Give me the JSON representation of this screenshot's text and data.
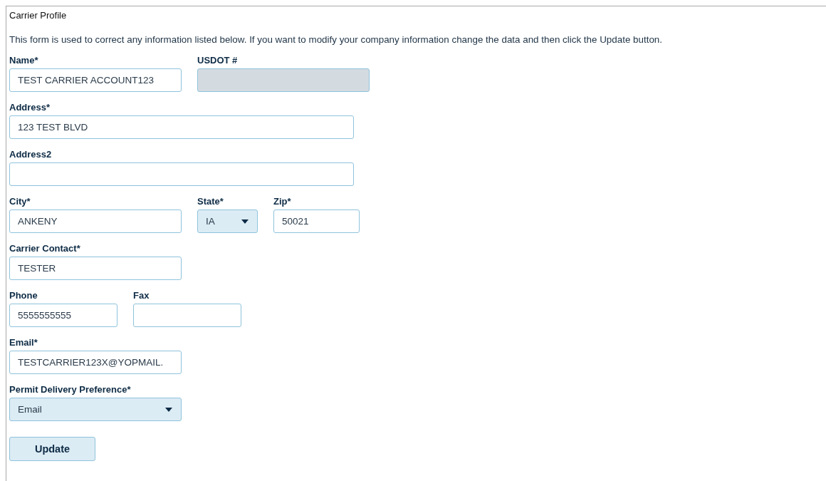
{
  "panel": {
    "title": "Carrier Profile",
    "description": "This form is used to correct any information listed below. If you want to modify your company information change the data and then click the Update button."
  },
  "rows": [
    [
      {
        "label": "Name*",
        "kind": "text",
        "value": "TEST CARRIER ACCOUNT123",
        "disabled": false
      },
      {
        "label": "USDOT #",
        "kind": "text",
        "disabled": true
      }
    ],
    [
      {
        "label": "Address*",
        "kind": "text",
        "value": "123 TEST BLVD",
        "disabled": false
      }
    ],
    [
      {
        "label": "Address2",
        "kind": "text",
        "disabled": false
      }
    ],
    [
      {
        "label": "City*",
        "kind": "text",
        "value": "ANKENY",
        "disabled": false
      },
      {
        "label": "State*",
        "kind": "select",
        "value": "IA",
        "disabled": false
      },
      {
        "label": "Zip*",
        "kind": "text",
        "value": "50021",
        "disabled": false
      }
    ],
    [
      {
        "label": "Carrier Contact*",
        "kind": "text",
        "value": "TESTER",
        "disabled": false
      }
    ],
    [
      {
        "label": "Phone",
        "kind": "text",
        "value": "5555555555",
        "disabled": false
      },
      {
        "label": "Fax",
        "kind": "text",
        "disabled": false
      }
    ],
    [
      {
        "label": "Email*",
        "kind": "text",
        "value": "TESTCARRIER123X@YOPMAIL.",
        "disabled": false
      }
    ],
    [
      {
        "label": "Permit Delivery Preference*",
        "kind": "select",
        "value": "Email",
        "disabled": false
      }
    ]
  ],
  "buttons": [
    "Update"
  ]
}
